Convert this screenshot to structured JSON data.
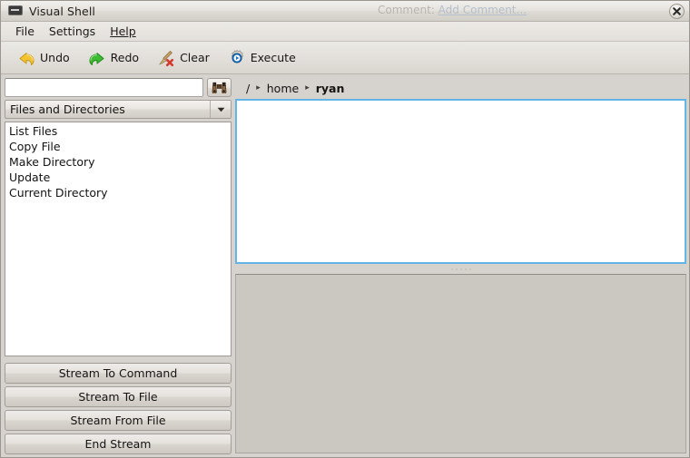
{
  "window": {
    "title": "Visual Shell",
    "icon": "terminal-icon",
    "comment_label": "Comment:",
    "comment_link": "Add Comment...",
    "close_label": "Close"
  },
  "menubar": {
    "items": [
      {
        "label": "File",
        "mnemonic": ""
      },
      {
        "label": "Settings",
        "mnemonic": ""
      },
      {
        "label": "Help",
        "mnemonic": "H"
      }
    ]
  },
  "toolbar": {
    "buttons": [
      {
        "label": "Undo",
        "icon": "undo-arrow-icon"
      },
      {
        "label": "Redo",
        "icon": "redo-arrow-icon"
      },
      {
        "label": "Clear",
        "icon": "broom-clear-icon"
      },
      {
        "label": "Execute",
        "icon": "gear-play-execute-icon"
      }
    ]
  },
  "sidebar": {
    "search": {
      "value": "",
      "placeholder": "",
      "button_icon": "binoculars-search-icon"
    },
    "category": {
      "selected": "Files and Directories",
      "arrow_icon": "chevron-down-icon"
    },
    "commands": [
      "List Files",
      "Copy File",
      "Make Directory",
      "Update",
      "Current Directory"
    ],
    "stream_buttons": [
      "Stream To Command",
      "Stream To File",
      "Stream From File",
      "End Stream"
    ]
  },
  "main": {
    "breadcrumb": [
      {
        "label": "/",
        "current": false
      },
      {
        "label": "home",
        "current": false
      },
      {
        "label": "ryan",
        "current": true
      }
    ],
    "breadcrumb_separator": "▸",
    "output_text": "",
    "console_text": ""
  },
  "colors": {
    "window_bg": "#d6d3ce",
    "titlebar_top": "#f2f0ed",
    "focus_border": "#63b5e8",
    "panel_white": "#ffffff",
    "console_bg": "#cbc7c1",
    "text": "#151413",
    "comment_text": "#b8b5b0"
  }
}
